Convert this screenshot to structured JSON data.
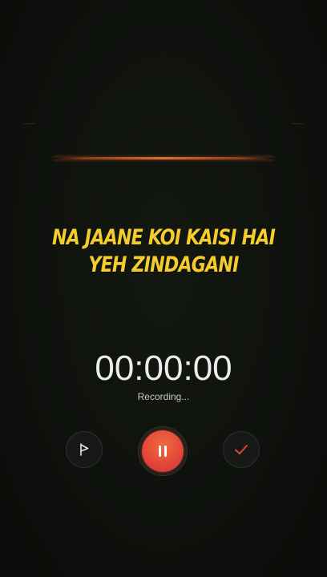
{
  "waveform": {
    "accent_color": "#e4702e"
  },
  "lyrics": {
    "line1": "NA JAANE KOI KAISI HAI",
    "line2": "YEH ZINDAGANI",
    "color": "#f4cc2c"
  },
  "recorder": {
    "timer": "00:00:00",
    "status": "Recording..."
  },
  "controls": {
    "flag_icon": "flag-icon",
    "pause_icon": "pause-icon",
    "done_icon": "checkmark-icon",
    "pause_color": "#e2463a",
    "check_color": "#e0413d"
  }
}
